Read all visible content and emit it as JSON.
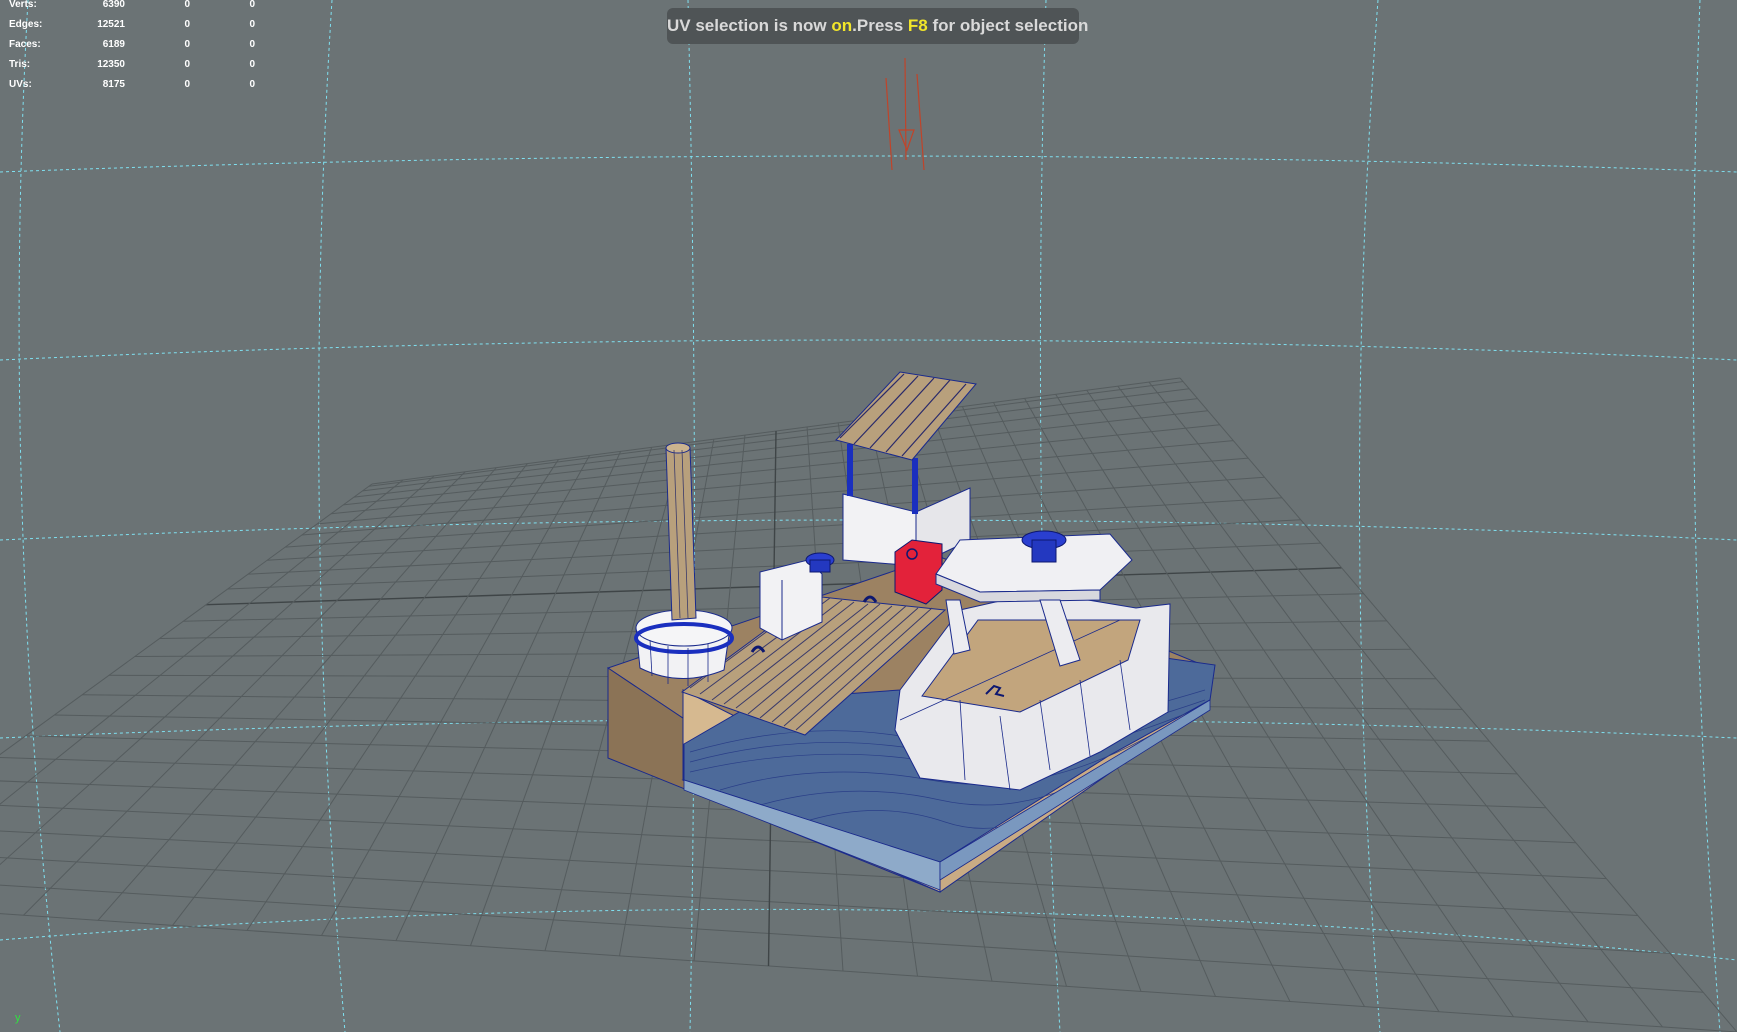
{
  "hud": {
    "rows": [
      {
        "label": "Verts:",
        "values": [
          "6390",
          "0",
          "0"
        ]
      },
      {
        "label": "Edges:",
        "values": [
          "12521",
          "0",
          "0"
        ]
      },
      {
        "label": "Faces:",
        "values": [
          "6189",
          "0",
          "0"
        ]
      },
      {
        "label": "Tris:",
        "values": [
          "12350",
          "0",
          "0"
        ]
      },
      {
        "label": "UVs:",
        "values": [
          "8175",
          "0",
          "0"
        ]
      }
    ]
  },
  "toast": {
    "part1": "UV selection is now ",
    "part2": "on",
    "part3": ".Press ",
    "part4": "F8",
    "part5": " for object selection"
  },
  "axis_label": "y",
  "colors": {
    "background": "#6b7375",
    "grid": "#5a6163",
    "grid_major": "#3f4547",
    "guide": "#7fe0f0",
    "highlight": "#f2e62a",
    "wireframe": "#1a2a8c",
    "wood": "#c9a97e",
    "selected": "#e3223a",
    "water": "#4d6a9a"
  }
}
